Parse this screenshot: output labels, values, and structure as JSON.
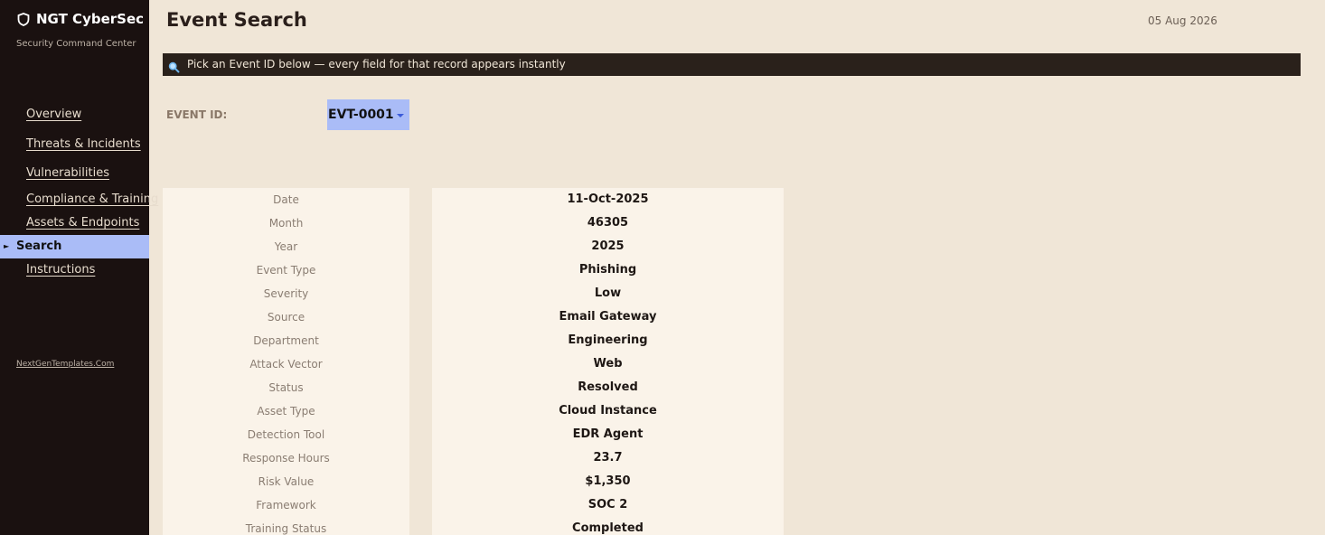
{
  "sidebar": {
    "brand": "NGT CyberSec",
    "subtitle": "Security Command Center",
    "items": [
      {
        "label": "Overview",
        "active": false
      },
      {
        "label": "Threats & Incidents",
        "active": false
      },
      {
        "label": "Vulnerabilities",
        "active": false
      },
      {
        "label": "Compliance & Training",
        "active": false
      },
      {
        "label": "Assets & Endpoints",
        "active": false
      },
      {
        "label": "Search",
        "active": true
      },
      {
        "label": "Instructions",
        "active": false
      }
    ],
    "footer_link": "NextGenTemplates.Com"
  },
  "header": {
    "title": "Event Search",
    "date": "05 Aug 2026"
  },
  "banner": {
    "icon": "magnifier-icon",
    "text": "Pick an Event ID below — every field for that record appears instantly"
  },
  "selector": {
    "label": "EVENT ID:",
    "value": "EVT-0001"
  },
  "record": [
    {
      "field": "Date",
      "value": "11-Oct-2025"
    },
    {
      "field": "Month",
      "value": "46305"
    },
    {
      "field": "Year",
      "value": "2025"
    },
    {
      "field": "Event Type",
      "value": "Phishing"
    },
    {
      "field": "Severity",
      "value": "Low"
    },
    {
      "field": "Source",
      "value": "Email Gateway"
    },
    {
      "field": "Department",
      "value": "Engineering"
    },
    {
      "field": "Attack Vector",
      "value": "Web"
    },
    {
      "field": "Status",
      "value": "Resolved"
    },
    {
      "field": "Asset Type",
      "value": "Cloud Instance"
    },
    {
      "field": "Detection Tool",
      "value": "EDR Agent"
    },
    {
      "field": "Response Hours",
      "value": "23.7"
    },
    {
      "field": "Risk Value",
      "value": "$1,350"
    },
    {
      "field": "Framework",
      "value": "SOC 2"
    },
    {
      "field": "Training Status",
      "value": "Completed"
    }
  ],
  "colors": {
    "sidebar_bg": "#1a1110",
    "active_accent": "#aabcf7",
    "page_bg": "#f0e6d7",
    "banner_bg": "#2a211b",
    "card_bg": "#faf3e9"
  }
}
